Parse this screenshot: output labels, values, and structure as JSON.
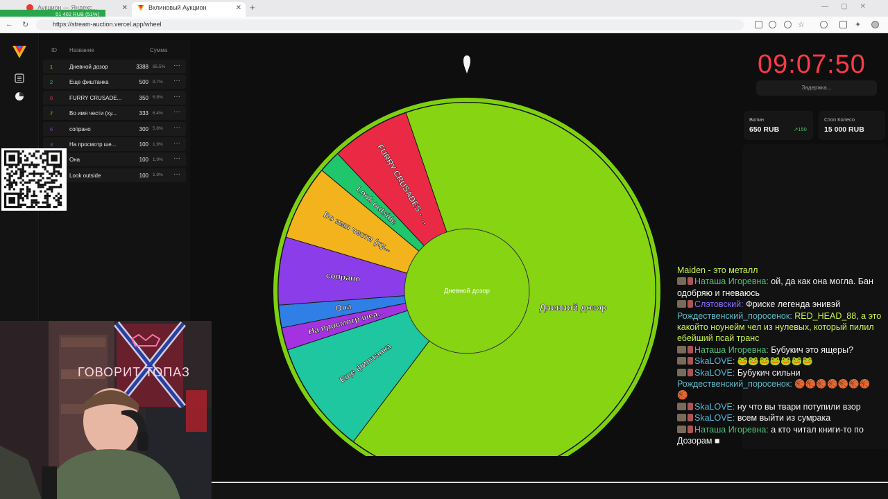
{
  "browser": {
    "tabs": [
      {
        "label": "Аукцион — Яндекс...",
        "active": false
      },
      {
        "label": "Вклиновый Аукцион",
        "active": true
      }
    ],
    "url": "https://stream-auction.vercel.app/wheel",
    "donation_bar": "51 402 RUB (51%)"
  },
  "lots": {
    "headers": {
      "id": "ID",
      "name": "Название",
      "sum": "Сумма"
    },
    "items": [
      {
        "id": "1",
        "name": "Дневной дозор",
        "sum": "3388",
        "pct": "65.5%",
        "color": "#8fd11a"
      },
      {
        "id": "2",
        "name": "Еще фиштанка",
        "sum": "500",
        "pct": "9.7%",
        "color": "#22c7a0"
      },
      {
        "id": "8",
        "name": "FURRY CRUSADE...",
        "sum": "350",
        "pct": "6.8%",
        "color": "#e62945"
      },
      {
        "id": "7",
        "name": "Во имя чести (ху...",
        "sum": "333",
        "pct": "6.4%",
        "color": "#f0b81c"
      },
      {
        "id": "6",
        "name": "сопрано",
        "sum": "300",
        "pct": "5.8%",
        "color": "#8a3ee6"
      },
      {
        "id": "3",
        "name": "На просмотр ше...",
        "sum": "100",
        "pct": "1.9%",
        "color": "#9b3bd9"
      },
      {
        "id": "4",
        "name": "Она",
        "sum": "100",
        "pct": "1.9%",
        "color": "#2d7fe0"
      },
      {
        "id": "5",
        "name": "Look outside",
        "sum": "100",
        "pct": "1.9%",
        "color": "#1ec76a"
      }
    ],
    "menu_glyph": "···"
  },
  "wheel": {
    "center_label": "Дневной дозор",
    "segments": [
      {
        "label": "Дневной дозор",
        "value": 3388,
        "color": "#86d412"
      },
      {
        "label": "Еще фиштанка",
        "value": 500,
        "color": "#1fc7a0"
      },
      {
        "label": "На просмотр шеа...",
        "value": 100,
        "color": "#a532e0"
      },
      {
        "label": "Она",
        "value": 100,
        "color": "#2f7fe6"
      },
      {
        "label": "сопрано",
        "value": 300,
        "color": "#8b3dea"
      },
      {
        "label": "Во имя чести (ху...",
        "value": 333,
        "color": "#f2b31c"
      },
      {
        "label": "Look outside",
        "value": 100,
        "color": "#20c66c"
      },
      {
        "label": "FURRY CRUSADES - ...",
        "value": 350,
        "color": "#ea2a45"
      }
    ]
  },
  "timer": {
    "value": "09:07:50",
    "delay_button": "Задержка..."
  },
  "stats": [
    {
      "label": "Вклин",
      "value": "650 RUB",
      "delta": "↗150"
    },
    {
      "label": "Стоп Колесо",
      "value": "15 000 RUB",
      "delta": ""
    }
  ],
  "chat": [
    {
      "nick": "",
      "text": "Maiden - это металл",
      "style": "hl"
    },
    {
      "nick": "Наташа Игоревна:",
      "text": " ой, да как она могла. Бан",
      "style": "nick-green",
      "badge": true
    },
    {
      "nick": "",
      "text": "одобряю и гневаюсь",
      "style": ""
    },
    {
      "nick": "Слэтовский:",
      "text": " Фриске легенда энивэй",
      "style": "nick-purple",
      "badge": true
    },
    {
      "nick": "Рождественский_поросенок:",
      "text": " RED_HEAD_88, а это",
      "style": "nick-blue",
      "hl": true
    },
    {
      "nick": "",
      "text": "какойто ноунейм чел из нулевых, который пилил",
      "style": "hl"
    },
    {
      "nick": "",
      "text": "ебейший псай транс",
      "style": "hl"
    },
    {
      "nick": "Наташа Игоревна:",
      "text": " Бубукич это ящеры?",
      "style": "nick-green",
      "badge": true
    },
    {
      "nick": "SkaLOVE:",
      "text": " 🐸🐸🐸🐸🐸🐸🐸",
      "style": "nick-cyan",
      "badge": true
    },
    {
      "nick": "SkaLOVE:",
      "text": " Бубукич сильни",
      "style": "nick-cyan",
      "badge": true
    },
    {
      "nick": "Рождественский_поросенок:",
      "text": " 🏀🏀🏀🏀🏀🏀🏀",
      "style": "nick-blue"
    },
    {
      "nick": "",
      "text": "🏀",
      "style": ""
    },
    {
      "nick": "SkaLOVE:",
      "text": " ну что вы твари потупили взор",
      "style": "nick-cyan",
      "badge": true
    },
    {
      "nick": "SkaLOVE:",
      "text": " всем выйти из сумрака",
      "style": "nick-cyan",
      "badge": true
    },
    {
      "nick": "Наташа Игоревна:",
      "text": " а кто читал книги-то по",
      "style": "nick-green",
      "badge": true
    },
    {
      "nick": "",
      "text": "Дозорам ■",
      "style": ""
    }
  ],
  "webcam": {
    "neon_sign": "ГОВОРИТ ТОПАЗ"
  }
}
